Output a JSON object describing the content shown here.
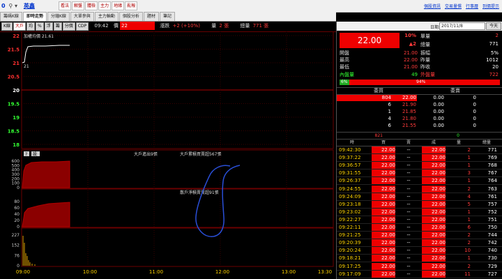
{
  "top": {
    "symbol_code": "0",
    "symbol_name": "英鑫",
    "tools": [
      "看法",
      "解盤",
      "體檢",
      "主力",
      "地緣",
      "亂報"
    ],
    "links": [
      "個股資訊",
      "交易量慣",
      "行事曆",
      "到價提示"
    ]
  },
  "tabs": [
    {
      "label": "籌碼K線",
      "active": false
    },
    {
      "label": "即時走勢",
      "active": true
    },
    {
      "label": "分鐘K線",
      "active": false
    },
    {
      "label": "大單參與",
      "active": false
    },
    {
      "label": "主力輪動",
      "active": false
    },
    {
      "label": "個股分析",
      "active": false
    },
    {
      "label": "題材",
      "active": false
    },
    {
      "label": "筆記",
      "active": false
    }
  ],
  "chart_header": {
    "buttons": [
      {
        "label": "K線",
        "on": false
      },
      {
        "label": "大戶",
        "on": true
      },
      {
        "label": "均",
        "on": false
      },
      {
        "label": "%",
        "on": false
      },
      {
        "label": "浮",
        "on": false
      },
      {
        "label": "籌",
        "on": false
      },
      {
        "label": "分價",
        "on": false
      },
      {
        "label": "CDP",
        "on": false
      }
    ],
    "time": "09:42",
    "price_label": "價",
    "price": "22",
    "change_label": "漲跌",
    "change": "+2 (+10%)",
    "vol_label": "量",
    "vol": "2 張",
    "total_label": "總量",
    "total": "771 張"
  },
  "chart": {
    "ma_label": "加權均價 21.61",
    "price_ticks": [
      "22",
      "21.5",
      "21",
      "20.5",
      "20",
      "19.5",
      "19",
      "18.5",
      "18"
    ],
    "price_last": "21",
    "panel2_q": "?",
    "panel2_btn": "設",
    "panel2_mid": "大戶進出9張",
    "panel2_right": "大戶累積買賣超567張",
    "panel2_ticks": [
      "600",
      "500",
      "400",
      "300",
      "200",
      "100",
      "0"
    ],
    "panel3_title": "散戶淨積賣賣超91張",
    "panel3_ticks": [
      "80",
      "60",
      "40",
      "20",
      "0"
    ],
    "panel4_ticks": [
      "227",
      "152",
      "76",
      "0"
    ],
    "time_ticks": [
      "09:00",
      "10:00",
      "11:00",
      "12:00",
      "13:00",
      "13:30"
    ],
    "colors": {
      "up": "#ff2020",
      "line": "#ffffff",
      "avg": "#ffd400",
      "fill": "#8b0000",
      "grid": "#6a0000"
    }
  },
  "panel": {
    "date_label": "日期:",
    "date": "2017/11/8",
    "today_btn": "今天",
    "quote": {
      "price": "22.00",
      "pct": "10%",
      "chg": "▲2",
      "unit_label": "單量",
      "unit": "2",
      "total_label": "總量",
      "total": "771"
    },
    "stats": [
      {
        "l1": "開盤",
        "v1": "21.00",
        "l2": "振幅",
        "v2": "5%"
      },
      {
        "l1": "最高",
        "v1": "22.00",
        "l2": "昨量",
        "v2": "1012"
      },
      {
        "l1": "最低",
        "v1": "21.00",
        "l2": "昨收",
        "v2": "20"
      }
    ],
    "inner_label": "內盤量",
    "inner": "49",
    "outer_label": "外盤量",
    "outer": "722",
    "ratio_left": "6%",
    "ratio_right": "94%",
    "ob_buy_hdr": "委買",
    "ob_sell_hdr": "委賣",
    "orderbook": [
      {
        "bq": "804",
        "bp": "22.00",
        "sp": "0.00",
        "sq": "0"
      },
      {
        "bq": "6",
        "bp": "21.90",
        "sp": "0.00",
        "sq": "0"
      },
      {
        "bq": "1",
        "bp": "21.85",
        "sp": "0.00",
        "sq": "0"
      },
      {
        "bq": "4",
        "bp": "21.80",
        "sp": "0.00",
        "sq": "0"
      },
      {
        "bq": "6",
        "bp": "21.55",
        "sp": "0.00",
        "sq": "0"
      }
    ],
    "ob_sum_left": "821",
    "ob_sum_right": "0",
    "ticks_hdr": [
      "時",
      "買",
      "賣",
      "成",
      "量",
      "總量"
    ],
    "ticks": [
      {
        "t": "09:42:30",
        "b": "22.00",
        "s": "--",
        "p": "22.00",
        "q": "2",
        "tot": "771"
      },
      {
        "t": "09:37:22",
        "b": "22.00",
        "s": "--",
        "p": "22.00",
        "q": "1",
        "tot": "769"
      },
      {
        "t": "09:36:57",
        "b": "22.00",
        "s": "--",
        "p": "22.00",
        "q": "1",
        "tot": "768"
      },
      {
        "t": "09:31:55",
        "b": "22.00",
        "s": "--",
        "p": "22.00",
        "q": "3",
        "tot": "767"
      },
      {
        "t": "09:26:37",
        "b": "22.00",
        "s": "--",
        "p": "22.00",
        "q": "1",
        "tot": "764"
      },
      {
        "t": "09:24:55",
        "b": "22.00",
        "s": "--",
        "p": "22.00",
        "q": "2",
        "tot": "763"
      },
      {
        "t": "09:24:09",
        "b": "22.00",
        "s": "--",
        "p": "22.00",
        "q": "4",
        "tot": "761"
      },
      {
        "t": "09:23:18",
        "b": "22.00",
        "s": "--",
        "p": "22.00",
        "q": "5",
        "tot": "757"
      },
      {
        "t": "09:23:02",
        "b": "22.00",
        "s": "--",
        "p": "22.00",
        "q": "1",
        "tot": "752"
      },
      {
        "t": "09:22:27",
        "b": "22.00",
        "s": "--",
        "p": "22.00",
        "q": "1",
        "tot": "751"
      },
      {
        "t": "09:22:11",
        "b": "22.00",
        "s": "--",
        "p": "22.00",
        "q": "6",
        "tot": "750"
      },
      {
        "t": "09:21:25",
        "b": "22.00",
        "s": "--",
        "p": "22.00",
        "q": "2",
        "tot": "744"
      },
      {
        "t": "09:20:39",
        "b": "22.00",
        "s": "--",
        "p": "22.00",
        "q": "2",
        "tot": "742"
      },
      {
        "t": "09:20:24",
        "b": "22.00",
        "s": "--",
        "p": "22.00",
        "q": "10",
        "tot": "740"
      },
      {
        "t": "09:18:21",
        "b": "22.00",
        "s": "--",
        "p": "22.00",
        "q": "1",
        "tot": "730"
      },
      {
        "t": "09:17:25",
        "b": "22.00",
        "s": "--",
        "p": "22.00",
        "q": "2",
        "tot": "729"
      },
      {
        "t": "09:17:09",
        "b": "22.00",
        "s": "--",
        "p": "22.00",
        "q": "11",
        "tot": "727"
      }
    ]
  }
}
